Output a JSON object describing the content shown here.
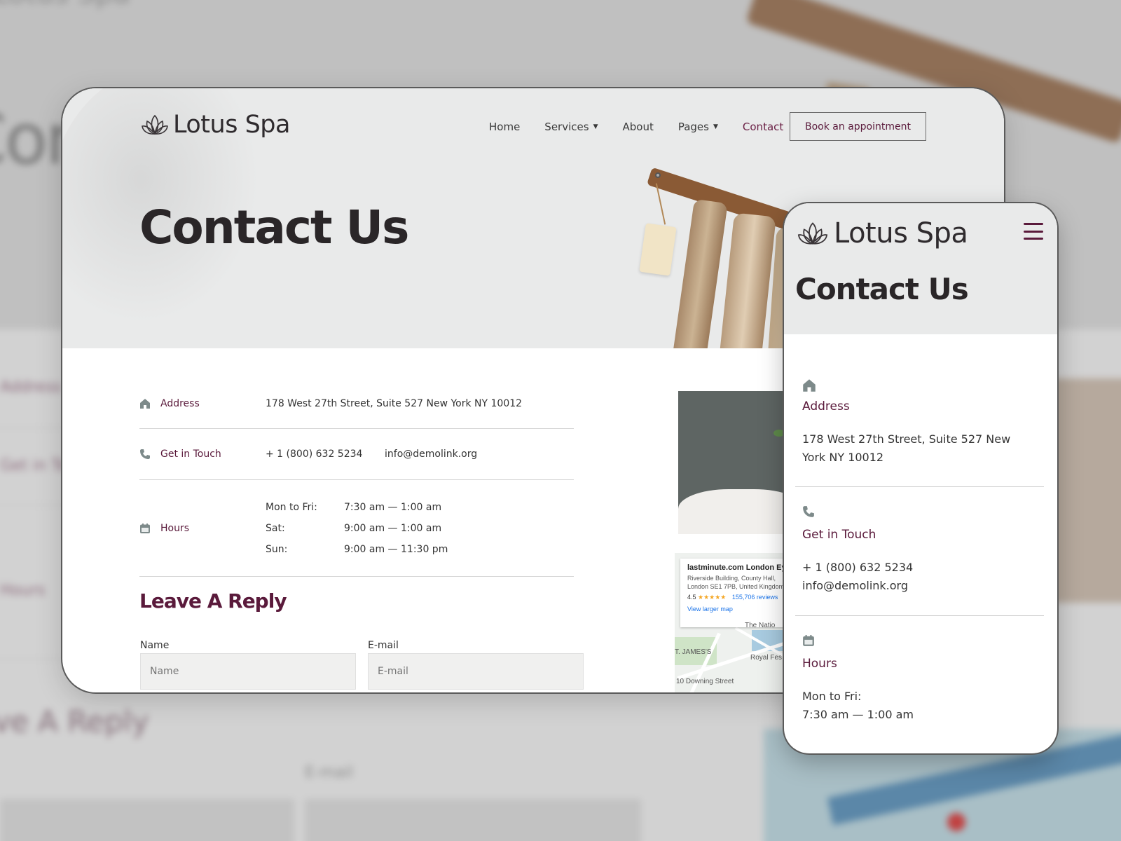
{
  "site": {
    "logo_text": "Lotus Spa"
  },
  "nav": {
    "items": [
      {
        "label": "Home",
        "has_dropdown": false,
        "active": false
      },
      {
        "label": "Services",
        "has_dropdown": true,
        "active": false
      },
      {
        "label": "About",
        "has_dropdown": false,
        "active": false
      },
      {
        "label": "Pages",
        "has_dropdown": true,
        "active": false
      },
      {
        "label": "Contact",
        "has_dropdown": false,
        "active": true
      }
    ],
    "cta": "Book an appointment"
  },
  "hero": {
    "title": "Contact Us"
  },
  "contact": {
    "address_label": "Address",
    "address_value": "178 West 27th Street, Suite 527 New York NY 10012",
    "touch_label": "Get in Touch",
    "phone": "+ 1 (800) 632 5234",
    "email": "info@demolink.org",
    "hours_label": "Hours",
    "hours": [
      {
        "day": "Mon to Fri:",
        "time": "7:30 am — 1:00 am"
      },
      {
        "day": "Sat:",
        "time": "9:00 am — 1:00 am"
      },
      {
        "day": "Sun:",
        "time": "9:00 am — 11:30 pm"
      }
    ]
  },
  "reply": {
    "title": "Leave A Reply",
    "name_label": "Name",
    "name_placeholder": "Name",
    "email_label": "E-mail",
    "email_placeholder": "E-mail"
  },
  "map": {
    "place_name": "lastminute.com London Eye",
    "address_line1": "Riverside Building, County Hall,",
    "address_line2": "London SE1 7PB, United Kingdom",
    "rating": "4.5",
    "stars": "★★★★★",
    "reviews": "155,706 reviews",
    "link": "View larger map",
    "labels": [
      "The Natio",
      "T. JAMES'S",
      "Royal Fes",
      "10 Downing Street"
    ]
  },
  "mobile": {
    "logo_text": "Lotus Spa",
    "title": "Contact Us",
    "address_label": "Address",
    "address_value": "178 West 27th Street, Suite 527 New York NY 10012",
    "touch_label": "Get in Touch",
    "phone": "+ 1 (800) 632 5234",
    "email": "info@demolink.org",
    "hours_label": "Hours",
    "hours_day": "Mon to Fri:",
    "hours_time": "7:30 am — 1:00 am"
  },
  "background": {
    "title_fragment": "Con",
    "logo_fragment": "Lotus Spa",
    "labels": [
      "Address",
      "Get in To",
      "Hours"
    ],
    "reply_fragment": "ve A Reply",
    "email_label": "E-mail"
  },
  "colors": {
    "accent": "#5a1a3b",
    "hero_bg": "#e9eaea",
    "icon_gray": "#7d8a8a"
  }
}
